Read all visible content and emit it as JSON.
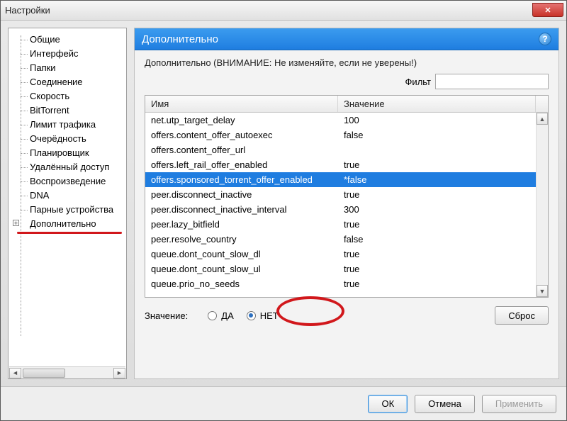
{
  "window": {
    "title": "Настройки"
  },
  "tree": {
    "items": [
      {
        "label": "Общие"
      },
      {
        "label": "Интерфейс"
      },
      {
        "label": "Папки"
      },
      {
        "label": "Соединение"
      },
      {
        "label": "Скорость"
      },
      {
        "label": "BitTorrent"
      },
      {
        "label": "Лимит трафика"
      },
      {
        "label": "Очерёдность"
      },
      {
        "label": "Планировщик"
      },
      {
        "label": "Удалённый доступ"
      },
      {
        "label": "Воспроизведение"
      },
      {
        "label": "DNA"
      },
      {
        "label": "Парные устройства"
      },
      {
        "label": "Дополнительно",
        "expandable": true
      }
    ]
  },
  "panel": {
    "title": "Дополнительно",
    "warning": "Дополнительно (ВНИМАНИЕ: Не изменяйте, если не уверены!)",
    "filter_label": "Фильт",
    "columns": {
      "name": "Имя",
      "value": "Значение"
    },
    "rows": [
      {
        "name": "net.utp_target_delay",
        "value": "100"
      },
      {
        "name": "offers.content_offer_autoexec",
        "value": "false"
      },
      {
        "name": "offers.content_offer_url",
        "value": ""
      },
      {
        "name": "offers.left_rail_offer_enabled",
        "value": "true"
      },
      {
        "name": "offers.sponsored_torrent_offer_enabled",
        "value": "*false",
        "selected": true
      },
      {
        "name": "peer.disconnect_inactive",
        "value": "true"
      },
      {
        "name": "peer.disconnect_inactive_interval",
        "value": "300"
      },
      {
        "name": "peer.lazy_bitfield",
        "value": "true"
      },
      {
        "name": "peer.resolve_country",
        "value": "false"
      },
      {
        "name": "queue.dont_count_slow_dl",
        "value": "true"
      },
      {
        "name": "queue.dont_count_slow_ul",
        "value": "true"
      },
      {
        "name": "queue.prio_no_seeds",
        "value": "true"
      }
    ],
    "value_label": "Значение:",
    "radio_yes": "ДА",
    "radio_no": "НЕТ",
    "reset": "Сброс"
  },
  "buttons": {
    "ok": "ОК",
    "cancel": "Отмена",
    "apply": "Применить"
  }
}
